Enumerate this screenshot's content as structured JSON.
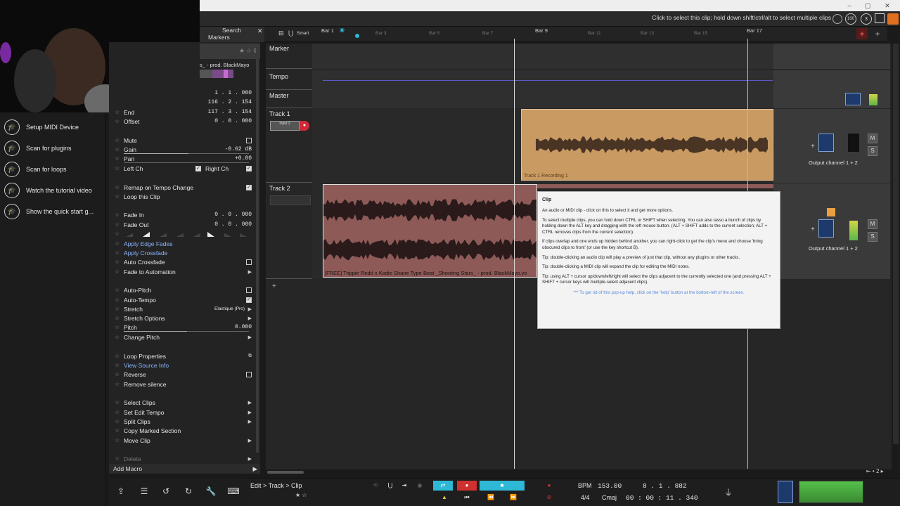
{
  "hint": "Click to select this clip; hold down shift/ctrl/alt to select multiple clips",
  "zoom": "100",
  "badge": "3",
  "panel_header": {
    "search": "Search",
    "markers": "Markers"
  },
  "clip_name": "s_ - prod. BlackMayo",
  "positions": {
    "start": "1 . 1 . 000",
    "length": "116 . 2 . 154",
    "end": "117 . 3 . 154",
    "end_label": "End",
    "offset_label": "Offset",
    "offset": "0 . 0 . 000"
  },
  "props": {
    "mute": "Mute",
    "gain": "Gain",
    "gain_value": "-0.62 dB",
    "pan": "Pan",
    "pan_value": "+0.00",
    "left_ch": "Left Ch",
    "right_ch": "Right Ch",
    "remap": "Remap on Tempo Change",
    "loop": "Loop this Clip",
    "fade_in": "Fade In",
    "fade_in_value": "0 . 0 . 000",
    "fade_out": "Fade Out",
    "fade_out_value": "0 . 0 . 000",
    "apply_edge": "Apply Edge Fades",
    "apply_cross": "Apply Crossfade",
    "auto_cross": "Auto Crossfade",
    "fade_auto": "Fade to Automation",
    "auto_pitch": "Auto-Pitch",
    "auto_tempo": "Auto-Tempo",
    "stretch": "Stretch",
    "stretch_value": "Elastique (Pro)",
    "stretch_opts": "Stretch Options",
    "pitch": "Pitch",
    "pitch_value": "0.000",
    "change_pitch": "Change Pitch",
    "loop_props": "Loop Properties",
    "view_source": "View Source Info",
    "reverse": "Reverse",
    "remove_silence": "Remove silence",
    "select_clips": "Select Clips",
    "set_edit_tempo": "Set Edit Tempo",
    "split_clips": "Split Clips",
    "copy_marked": "Copy Marked Section",
    "move_clip": "Move Clip",
    "delete": "Delete",
    "add_macro": "Add Macro"
  },
  "sidebar": [
    {
      "label": "Setup MIDI Device",
      "icon": "graduation-cap-icon"
    },
    {
      "label": "Scan for plugins",
      "icon": "graduation-cap-icon"
    },
    {
      "label": "Scan for loops",
      "icon": "graduation-cap-icon"
    },
    {
      "label": "Watch the tutorial video",
      "icon": "graduation-cap-icon"
    },
    {
      "label": "Show the quick start g...",
      "icon": "graduation-cap-icon"
    }
  ],
  "ruler": {
    "smart": "Smart",
    "bars": [
      "Bar 1",
      "Bar 3",
      "Bar 5",
      "Bar 7",
      "Bar 9",
      "Bar 11",
      "Bar 13",
      "Bar 15",
      "Bar 17"
    ]
  },
  "tracks": {
    "marker": "Marker",
    "tempo": "Tempo",
    "master": "Master",
    "track1": "Track 1",
    "track1_input": "Input 2",
    "track1_clip": "Track 1 Recording 1",
    "track2": "Track 2",
    "track2_clip": "[FREE] Trippie Redd x Kodie Shane Type Beat _Shooting Stars_ - prod. BlackMayo.yo",
    "output1": "Output channel 1 + 2",
    "output2": "Output channel 1 + 2"
  },
  "tooltip": {
    "title": "Clip",
    "lines": [
      "An audio or MIDI clip - click on this to select it and get more options.",
      "To select multiple clips, you can hold down CTRL or SHIFT when selecting. You can also lasso a bunch of clips by holding down the ALT key and dragging with the left mouse button. (ALT + SHIFT adds to the current selection; ALT + CTRL removes clips from the current selection).",
      "If clips overlap and one ends up hidden behind another, you can right-click to get the clip's menu and choose 'bring obscured clips to front' (or use the key shortcut B).",
      "Tip: double-clicking an audio clip will play a preview of just that clip, without any plugins or other tracks.",
      "Tip: double-clicking a MIDI clip will expand the clip for editing the MIDI notes.",
      "Tip: using ALT + cursor up/down/left/right will select the clips adjacent to the currently selected one (and pressing ALT + SHIFT + cursor keys will multiple-select adjacent clips)."
    ],
    "footer": "*** To get rid of this pop-up help, click on the 'help' button at the bottom-left of the screen."
  },
  "bottom": {
    "breadcrumb": "Edit > Track > Clip",
    "bpm_label": "BPM",
    "bpm": "153.00",
    "position": "8 . 1 . 882",
    "sig": "4/4",
    "key": "Cmaj",
    "time": "00 : 00 : 11 . 340",
    "page": "2"
  },
  "colors": {
    "accent": "#2fb8d6",
    "record": "#e03030",
    "clip_audio": "#c99a62",
    "clip_red": "#8e5a58"
  }
}
